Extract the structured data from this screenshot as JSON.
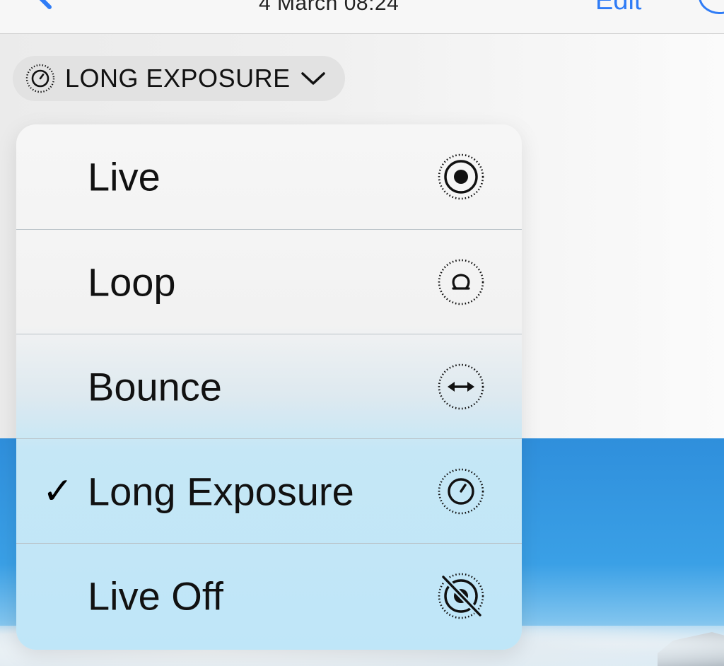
{
  "navbar": {
    "date_label": "4 March  08:24",
    "edit_label": "Edit",
    "accent_color": "#2f7cf6"
  },
  "mode_pill": {
    "label": "LONG EXPOSURE",
    "icon": "timer-icon",
    "chevron": "chevron-down-icon"
  },
  "menu": {
    "items": [
      {
        "label": "Live",
        "icon": "live-icon",
        "checked": false
      },
      {
        "label": "Loop",
        "icon": "loop-icon",
        "checked": false
      },
      {
        "label": "Bounce",
        "icon": "bounce-icon",
        "checked": false
      },
      {
        "label": "Long Exposure",
        "icon": "long-exposure-icon",
        "checked": true,
        "check_mark": "✓"
      },
      {
        "label": "Live Off",
        "icon": "live-off-icon",
        "checked": false
      }
    ]
  }
}
